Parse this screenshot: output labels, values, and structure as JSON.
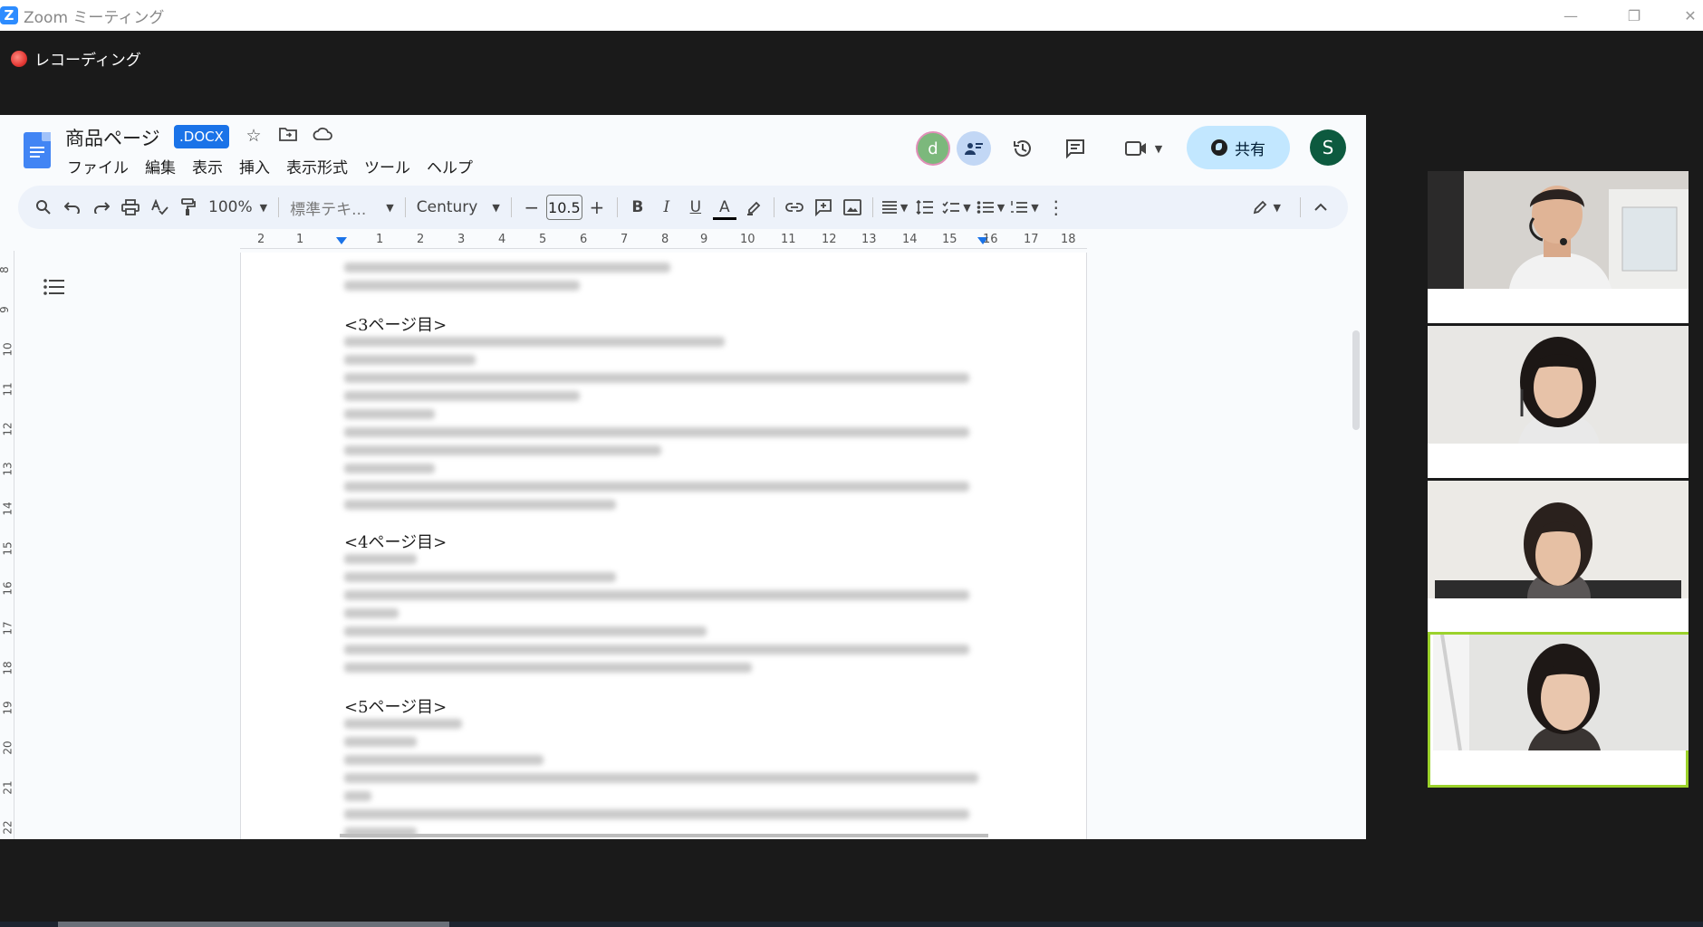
{
  "zoom": {
    "title": "Zoom ミーティング",
    "recording_label": "レコーディング",
    "logo_letter": "Z",
    "minimize": "—",
    "restore": "❐",
    "close": "✕"
  },
  "doc": {
    "title": "商品ページ",
    "badge": ".DOCX",
    "menu": [
      "ファイル",
      "編集",
      "表示",
      "挿入",
      "表示形式",
      "ツール",
      "ヘルプ"
    ],
    "collaborator_initial": "d",
    "share_label": "共有",
    "user_initial": "S",
    "toolbar": {
      "zoom": "100%",
      "style": "標準テキ...",
      "font": "Century",
      "font_size": "10.5",
      "bold": "B",
      "italic": "I",
      "underline": "U",
      "text_color": "A"
    },
    "ruler_top": [
      "2",
      "1",
      "1",
      "2",
      "3",
      "4",
      "5",
      "6",
      "7",
      "8",
      "9",
      "10",
      "11",
      "12",
      "13",
      "14",
      "15",
      "16",
      "17",
      "18"
    ],
    "ruler_left": [
      "8",
      "9",
      "10",
      "11",
      "12",
      "13",
      "14",
      "15",
      "16",
      "17",
      "18",
      "19",
      "20",
      "21",
      "22"
    ],
    "headings": [
      "<3ページ目>",
      "<4ページ目>",
      "<5ページ目>"
    ]
  },
  "participants": [
    "participant-1",
    "participant-2",
    "participant-3",
    "participant-4"
  ],
  "colors": {
    "active_speaker_border": "#9bd22b",
    "share_button": "#c2e7ff",
    "docs_blue": "#4285f4",
    "zoom_blue": "#2d8cff"
  }
}
